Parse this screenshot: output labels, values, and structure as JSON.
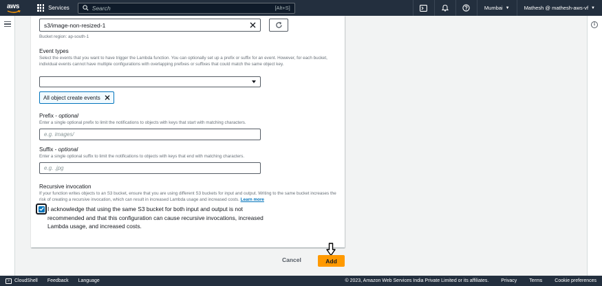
{
  "topbar": {
    "logo_text": "aws",
    "services_label": "Services",
    "search_placeholder": "Search",
    "search_shortcut": "[Alt+S]",
    "region": "Mumbai",
    "account": "Mathesh @ mathesh-aws-vf"
  },
  "form": {
    "bucket_value": "s3/image-non-resized-1",
    "bucket_region": "Bucket region: ap-south-1",
    "event_types": {
      "label": "Event types",
      "description": "Select the events that you want to have trigger the Lambda function. You can optionally set up a prefix or suffix for an event. However, for each bucket, individual events cannot have multiple configurations with overlapping prefixes or suffixes that could match the same object key.",
      "selected_token": "All object create events"
    },
    "prefix": {
      "label": "Prefix",
      "optional": "optional",
      "description": "Enter a single optional prefix to limit the notifications to objects with keys that start with matching characters.",
      "placeholder": "e.g. images/"
    },
    "suffix": {
      "label": "Suffix",
      "optional": "optional",
      "description": "Enter a single optional suffix to limit the notifications to objects with keys that end with matching characters.",
      "placeholder": "e.g. .jpg"
    },
    "recursive": {
      "label": "Recursive invocation",
      "description": "If your function writes objects to an S3 bucket, ensure that you are using different S3 buckets for input and output. Writing to the same bucket increases the risk of creating a recursive invocation, which can result in increased Lambda usage and increased costs.",
      "learn_more": "Learn more",
      "ack_line1": "I acknowledge that using the same S3 bucket for both input and output is not",
      "ack_line2": "recommended and that this configuration can cause recursive invocations, increased",
      "ack_line3": "Lambda usage, and increased costs.",
      "checked": true
    }
  },
  "actions": {
    "cancel": "Cancel",
    "add": "Add"
  },
  "footer": {
    "cloudshell": "CloudShell",
    "feedback": "Feedback",
    "language": "Language",
    "copyright": "© 2023, Amazon Web Services India Private Limited or its affiliates.",
    "privacy": "Privacy",
    "terms": "Terms",
    "cookies": "Cookie preferences"
  },
  "colors": {
    "nav_bg": "#232f3e",
    "accent": "#ff9900",
    "link": "#0073bb"
  }
}
